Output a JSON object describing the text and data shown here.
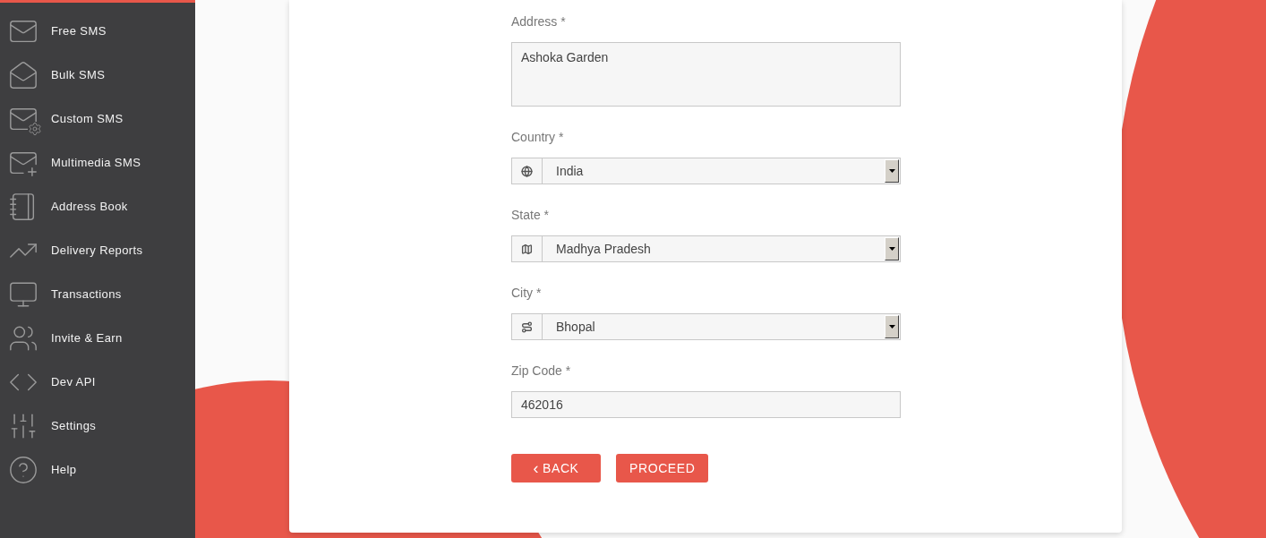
{
  "sidebar": {
    "items": [
      {
        "label": "Free SMS"
      },
      {
        "label": "Bulk SMS"
      },
      {
        "label": "Custom SMS"
      },
      {
        "label": "Multimedia SMS"
      },
      {
        "label": "Address Book"
      },
      {
        "label": "Delivery Reports"
      },
      {
        "label": "Transactions"
      },
      {
        "label": "Invite & Earn"
      },
      {
        "label": "Dev API"
      },
      {
        "label": "Settings"
      },
      {
        "label": "Help"
      }
    ]
  },
  "form": {
    "fields": [
      {
        "kind": "textarea",
        "label": "Address *",
        "value": "Ashoka Garden"
      },
      {
        "kind": "select",
        "label": "Country *",
        "value": "India"
      },
      {
        "kind": "select",
        "label": "State *",
        "value": "Madhya Pradesh"
      },
      {
        "kind": "select",
        "label": "City *",
        "value": "Bhopal"
      },
      {
        "kind": "text",
        "label": "Zip Code *",
        "value": "462016"
      }
    ],
    "buttons": [
      {
        "icon": "‹",
        "label": "BACK"
      },
      {
        "label": "PROCEED"
      }
    ]
  }
}
